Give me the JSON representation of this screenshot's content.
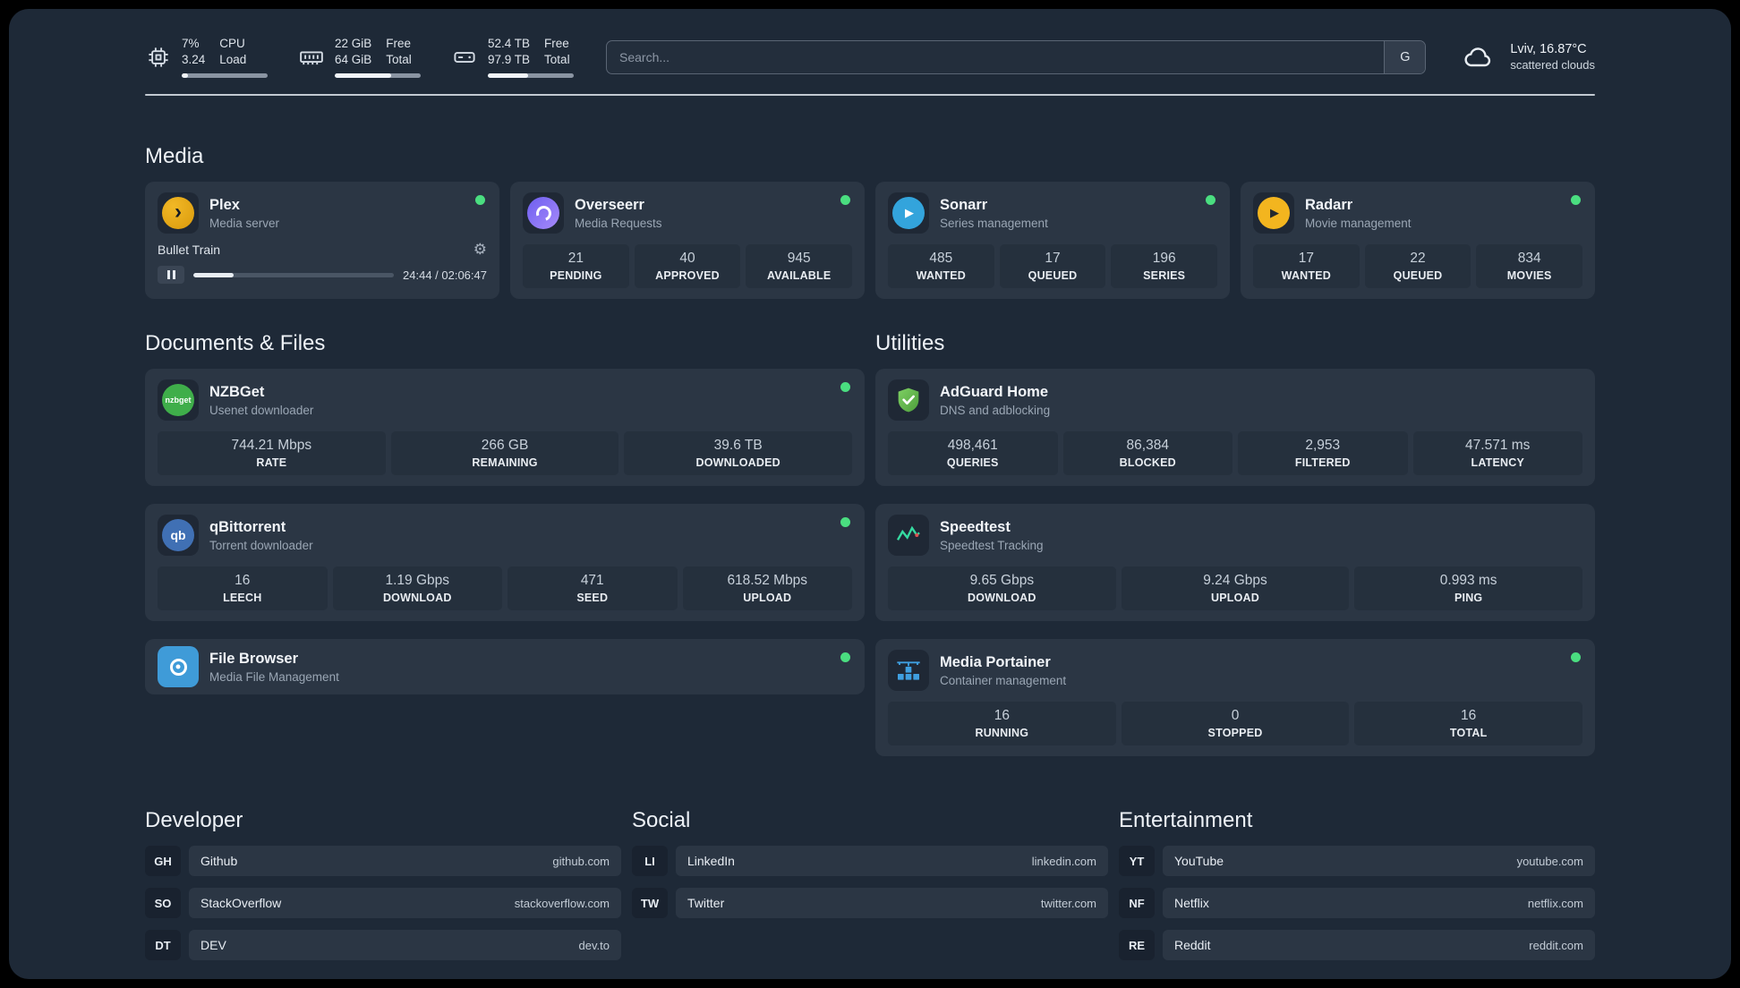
{
  "header": {
    "cpu": {
      "value_top": "7%",
      "value_bottom": "3.24",
      "label_top": "CPU",
      "label_bottom": "Load",
      "percent": 7
    },
    "ram": {
      "value_top": "22 GiB",
      "value_bottom": "64 GiB",
      "label_top": "Free",
      "label_bottom": "Total",
      "percent": 66
    },
    "disk": {
      "value_top": "52.4 TB",
      "value_bottom": "97.9 TB",
      "label_top": "Free",
      "label_bottom": "Total",
      "percent": 47
    },
    "search": {
      "placeholder": "Search...",
      "provider_button": "G"
    },
    "weather": {
      "location": "Lviv, 16.87°C",
      "condition": "scattered clouds"
    }
  },
  "sections": {
    "media": "Media",
    "documents": "Documents & Files",
    "utilities": "Utilities",
    "developer": "Developer",
    "social": "Social",
    "entertainment": "Entertainment"
  },
  "apps": {
    "plex": {
      "name": "Plex",
      "desc": "Media server",
      "status": "online",
      "player": {
        "title": "Bullet Train",
        "time": "24:44 / 02:06:47",
        "progress_percent": 20
      }
    },
    "overseerr": {
      "name": "Overseerr",
      "desc": "Media Requests",
      "status": "online",
      "stats": [
        {
          "value": "21",
          "label": "PENDING"
        },
        {
          "value": "40",
          "label": "APPROVED"
        },
        {
          "value": "945",
          "label": "AVAILABLE"
        }
      ]
    },
    "sonarr": {
      "name": "Sonarr",
      "desc": "Series management",
      "status": "online",
      "stats": [
        {
          "value": "485",
          "label": "WANTED"
        },
        {
          "value": "17",
          "label": "QUEUED"
        },
        {
          "value": "196",
          "label": "SERIES"
        }
      ]
    },
    "radarr": {
      "name": "Radarr",
      "desc": "Movie management",
      "status": "online",
      "stats": [
        {
          "value": "17",
          "label": "WANTED"
        },
        {
          "value": "22",
          "label": "QUEUED"
        },
        {
          "value": "834",
          "label": "MOVIES"
        }
      ]
    },
    "nzbget": {
      "name": "NZBGet",
      "desc": "Usenet downloader",
      "status": "online",
      "stats": [
        {
          "value": "744.21 Mbps",
          "label": "RATE"
        },
        {
          "value": "266 GB",
          "label": "REMAINING"
        },
        {
          "value": "39.6 TB",
          "label": "DOWNLOADED"
        }
      ]
    },
    "qbittorrent": {
      "name": "qBittorrent",
      "desc": "Torrent downloader",
      "status": "online",
      "stats": [
        {
          "value": "16",
          "label": "LEECH"
        },
        {
          "value": "1.19 Gbps",
          "label": "DOWNLOAD"
        },
        {
          "value": "471",
          "label": "SEED"
        },
        {
          "value": "618.52 Mbps",
          "label": "UPLOAD"
        }
      ]
    },
    "filebrowser": {
      "name": "File Browser",
      "desc": "Media File Management",
      "status": "online"
    },
    "adguard": {
      "name": "AdGuard Home",
      "desc": "DNS and adblocking",
      "stats": [
        {
          "value": "498,461",
          "label": "QUERIES"
        },
        {
          "value": "86,384",
          "label": "BLOCKED"
        },
        {
          "value": "2,953",
          "label": "FILTERED"
        },
        {
          "value": "47.571 ms",
          "label": "LATENCY"
        }
      ]
    },
    "speedtest": {
      "name": "Speedtest",
      "desc": "Speedtest Tracking",
      "stats": [
        {
          "value": "9.65 Gbps",
          "label": "DOWNLOAD"
        },
        {
          "value": "9.24 Gbps",
          "label": "UPLOAD"
        },
        {
          "value": "0.993 ms",
          "label": "PING"
        }
      ]
    },
    "portainer": {
      "name": "Media Portainer",
      "desc": "Container management",
      "status": "online",
      "stats": [
        {
          "value": "16",
          "label": "RUNNING"
        },
        {
          "value": "0",
          "label": "STOPPED"
        },
        {
          "value": "16",
          "label": "TOTAL"
        }
      ]
    }
  },
  "bookmarks": {
    "developer": [
      {
        "abbr": "GH",
        "name": "Github",
        "url": "github.com"
      },
      {
        "abbr": "SO",
        "name": "StackOverflow",
        "url": "stackoverflow.com"
      },
      {
        "abbr": "DT",
        "name": "DEV",
        "url": "dev.to"
      }
    ],
    "social": [
      {
        "abbr": "LI",
        "name": "LinkedIn",
        "url": "linkedin.com"
      },
      {
        "abbr": "TW",
        "name": "Twitter",
        "url": "twitter.com"
      }
    ],
    "entertainment": [
      {
        "abbr": "YT",
        "name": "YouTube",
        "url": "youtube.com"
      },
      {
        "abbr": "NF",
        "name": "Netflix",
        "url": "netflix.com"
      },
      {
        "abbr": "RE",
        "name": "Reddit",
        "url": "reddit.com"
      }
    ]
  },
  "icons": {
    "plex_glyph": "›",
    "sonarr_glyph": "▶",
    "radarr_glyph": "▶",
    "nzbget_text": "nzbget",
    "qbittorrent_text": "qb",
    "gear_glyph": "⚙"
  },
  "colors": {
    "status_online": "#4ade80",
    "plex": "#e5a00d",
    "overseerr": "#8b5cf6",
    "sonarr": "#33a4dc",
    "radarr": "#f3b51f",
    "nzbget": "#3fae4a",
    "qbittorrent": "#4070b4",
    "filebrowser": "#3f9bd8",
    "adguard": "#68bc4c",
    "speedtest": "#35dba1",
    "portainer": "#3f9fe0"
  }
}
